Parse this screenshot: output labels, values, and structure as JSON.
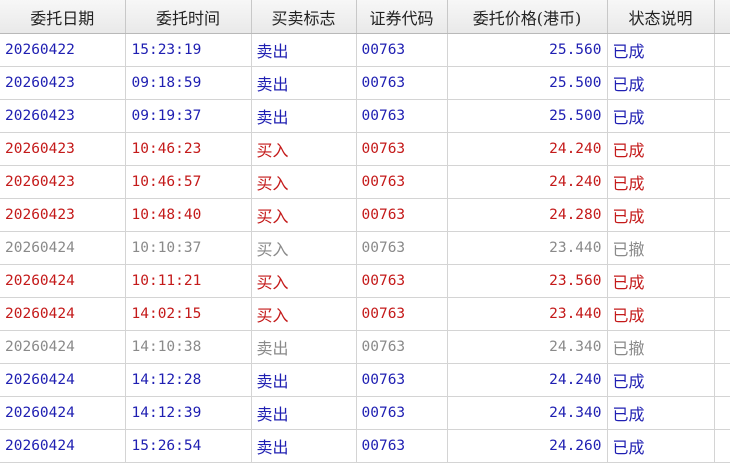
{
  "columns": [
    "委托日期",
    "委托时间",
    "买卖标志",
    "证券代码",
    "委托价格(港币)",
    "状态说明"
  ],
  "rows": [
    {
      "date": "20260422",
      "time": "15:23:19",
      "side": "卖出",
      "code": "00763",
      "price": "25.560",
      "status": "已成",
      "kind": "sell"
    },
    {
      "date": "20260423",
      "time": "09:18:59",
      "side": "卖出",
      "code": "00763",
      "price": "25.500",
      "status": "已成",
      "kind": "sell"
    },
    {
      "date": "20260423",
      "time": "09:19:37",
      "side": "卖出",
      "code": "00763",
      "price": "25.500",
      "status": "已成",
      "kind": "sell"
    },
    {
      "date": "20260423",
      "time": "10:46:23",
      "side": "买入",
      "code": "00763",
      "price": "24.240",
      "status": "已成",
      "kind": "buy"
    },
    {
      "date": "20260423",
      "time": "10:46:57",
      "side": "买入",
      "code": "00763",
      "price": "24.240",
      "status": "已成",
      "kind": "buy"
    },
    {
      "date": "20260423",
      "time": "10:48:40",
      "side": "买入",
      "code": "00763",
      "price": "24.280",
      "status": "已成",
      "kind": "buy"
    },
    {
      "date": "20260424",
      "time": "10:10:37",
      "side": "买入",
      "code": "00763",
      "price": "23.440",
      "status": "已撤",
      "kind": "cancel"
    },
    {
      "date": "20260424",
      "time": "10:11:21",
      "side": "买入",
      "code": "00763",
      "price": "23.560",
      "status": "已成",
      "kind": "buy"
    },
    {
      "date": "20260424",
      "time": "14:02:15",
      "side": "买入",
      "code": "00763",
      "price": "23.440",
      "status": "已成",
      "kind": "buy"
    },
    {
      "date": "20260424",
      "time": "14:10:38",
      "side": "卖出",
      "code": "00763",
      "price": "24.340",
      "status": "已撤",
      "kind": "cancel"
    },
    {
      "date": "20260424",
      "time": "14:12:28",
      "side": "卖出",
      "code": "00763",
      "price": "24.240",
      "status": "已成",
      "kind": "sell"
    },
    {
      "date": "20260424",
      "time": "14:12:39",
      "side": "卖出",
      "code": "00763",
      "price": "24.340",
      "status": "已成",
      "kind": "sell"
    },
    {
      "date": "20260424",
      "time": "15:26:54",
      "side": "卖出",
      "code": "00763",
      "price": "24.260",
      "status": "已成",
      "kind": "sell"
    }
  ],
  "colors": {
    "sell": "#1f1fb2",
    "buy": "#c41a1a",
    "cancelled": "#8a8a8a"
  }
}
